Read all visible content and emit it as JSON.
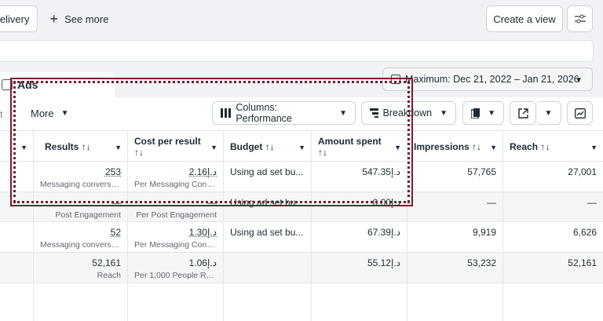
{
  "toolbar_top": {
    "delivery_label": "Delivery",
    "see_more_label": "See more",
    "create_view_label": "Create a view"
  },
  "ads_tab": {
    "label": "Ads"
  },
  "date_range": {
    "label": "Maximum: Dec 21, 2022 – Jan 21, 2026"
  },
  "table_toolbar": {
    "edit_partial": "t",
    "more_label": "More",
    "columns_label": "Columns: Performance",
    "breakdown_label": "Breakdown"
  },
  "columns": [
    {
      "label": "Results ↑↓"
    },
    {
      "label": "Cost per result ↑↓"
    },
    {
      "label": "Budget ↑↓"
    },
    {
      "label": "Amount spent ↑↓"
    },
    {
      "label": "Impressions ↑↓"
    },
    {
      "label": "Reach ↑↓"
    }
  ],
  "rows": [
    {
      "results": "253",
      "results_sub": "Messaging conversat...",
      "cpr": "2.16د.إ",
      "cpr_sub": "Per Messaging Conv...",
      "budget": "Using ad set bu...",
      "spent": "547.35د.إ",
      "impressions": "57,765",
      "reach": "27,001"
    },
    {
      "results": "—",
      "results_sub": "Post Engagement",
      "cpr": "—",
      "cpr_sub": "Per Post Engagement",
      "budget": "Using ad set bu...",
      "spent": "0.00د.إ",
      "impressions": "—",
      "reach": "—"
    },
    {
      "results": "52",
      "results_sub": "Messaging conversat...",
      "cpr": "1.30د.إ",
      "cpr_sub": "Per Messaging Conv...",
      "budget": "Using ad set bu...",
      "spent": "67.39د.إ",
      "impressions": "9,919",
      "reach": "6,626"
    },
    {
      "results": "52,161",
      "results_sub": "Reach",
      "cpr": "1.06د.إ",
      "cpr_sub": "Per 1,000 People Rea...",
      "budget": "",
      "spent": "55.12د.إ",
      "impressions": "53,232",
      "reach": "52,161"
    }
  ],
  "colors": {
    "highlight": "#7a1d2d",
    "border": "#cbd2d9"
  }
}
